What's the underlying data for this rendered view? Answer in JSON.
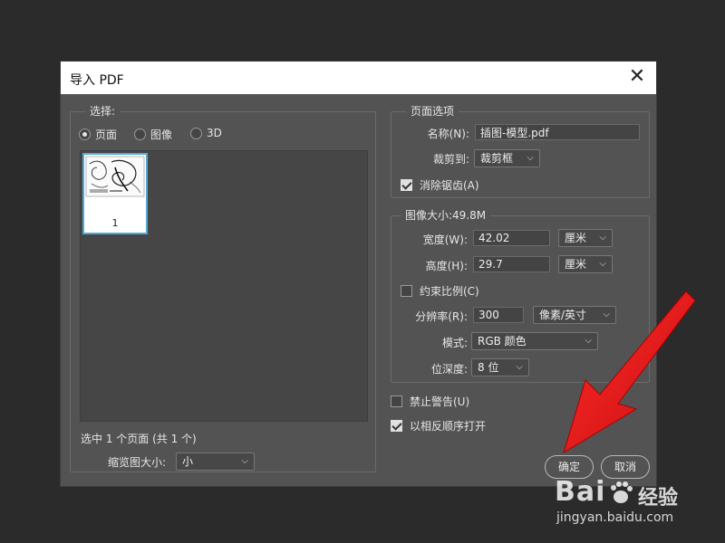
{
  "dialog": {
    "title": "导入 PDF",
    "close_glyph": "✕"
  },
  "left": {
    "select_legend": "选择:",
    "radios": [
      {
        "label": "页面",
        "selected": true
      },
      {
        "label": "图像",
        "selected": false
      },
      {
        "label": "3D",
        "selected": false
      }
    ],
    "thumbnail_page_number": "1",
    "selection_status": "选中 1 个页面 (共 1 个)",
    "thumb_size_label": "缩览图大小:",
    "thumb_size_value": "小"
  },
  "page_options": {
    "legend": "页面选项",
    "name_label": "名称(N):",
    "name_value": "插图-模型.pdf",
    "crop_label": "裁剪到:",
    "crop_value": "裁剪框",
    "antialias_label": "消除锯齿(A)",
    "antialias_checked": true
  },
  "image_size": {
    "legend": "图像大小:49.8M",
    "width_label": "宽度(W):",
    "width_value": "42.02",
    "width_unit": "厘米",
    "height_label": "高度(H):",
    "height_value": "29.7",
    "height_unit": "厘米",
    "constrain_label": "约束比例(C)",
    "constrain_checked": false,
    "resolution_label": "分辨率(R):",
    "resolution_value": "300",
    "resolution_unit": "像素/英寸",
    "mode_label": "模式:",
    "mode_value": "RGB 颜色",
    "depth_label": "位深度:",
    "depth_value": "8 位"
  },
  "options": {
    "suppress_warnings_label": "禁止警告(U)",
    "suppress_warnings_checked": false,
    "reverse_order_label": "以相反顺序打开",
    "reverse_order_checked": true
  },
  "buttons": {
    "ok": "确定",
    "cancel": "取消"
  },
  "watermark": {
    "logo": "Bai",
    "logo_suffix": "经验",
    "url": "jingyan.baidu.com"
  },
  "colors": {
    "arrow": "#e21a1a",
    "thumb_border": "#56a9d5"
  },
  "icons": {
    "close": "close-icon",
    "dropdown": "chevron-down-icon",
    "annotation": "red-arrow"
  }
}
